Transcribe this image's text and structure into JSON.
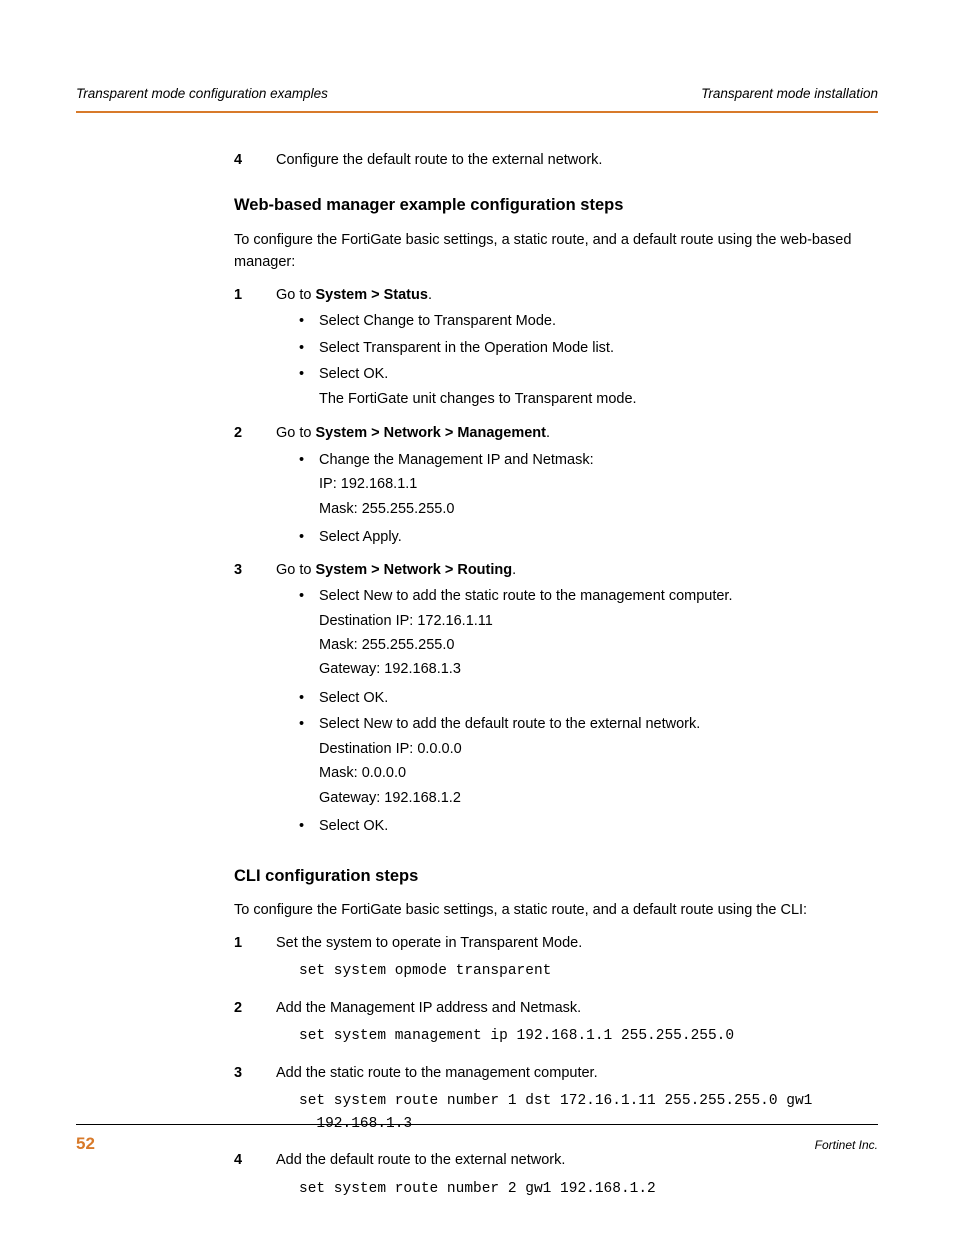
{
  "header": {
    "left": "Transparent mode configuration examples",
    "right": "Transparent mode installation"
  },
  "preStep": {
    "num": "4",
    "text": "Configure the default route to the external network."
  },
  "sectionA": {
    "title": "Web-based manager example configuration steps",
    "intro": "To configure the FortiGate basic settings, a static route, and a default route using the web-based manager:",
    "steps": [
      {
        "num": "1",
        "lead_pre": "Go to ",
        "lead_bold": "System > Status",
        "lead_post": ".",
        "bullets": [
          {
            "text": "Select Change to Transparent Mode."
          },
          {
            "text": "Select Transparent in the Operation Mode list."
          },
          {
            "text": "Select OK.",
            "sublines": [
              "The FortiGate unit changes to Transparent mode."
            ]
          }
        ]
      },
      {
        "num": "2",
        "lead_pre": "Go to ",
        "lead_bold": "System > Network > Management",
        "lead_post": ".",
        "bullets": [
          {
            "text": "Change the Management IP and Netmask:",
            "sublines": [
              "IP: 192.168.1.1",
              "Mask: 255.255.255.0"
            ]
          },
          {
            "text": "Select Apply."
          }
        ]
      },
      {
        "num": "3",
        "lead_pre": "Go to ",
        "lead_bold": "System > Network > Routing",
        "lead_post": ".",
        "bullets": [
          {
            "text": "Select New to add the static route to the management computer.",
            "sublines": [
              "Destination IP: 172.16.1.11",
              "Mask: 255.255.255.0",
              "Gateway: 192.168.1.3"
            ]
          },
          {
            "text": "Select OK."
          },
          {
            "text": "Select New to add the default route to the external network.",
            "sublines": [
              "Destination IP: 0.0.0.0",
              "Mask: 0.0.0.0",
              "Gateway: 192.168.1.2"
            ]
          },
          {
            "text": "Select OK."
          }
        ]
      }
    ]
  },
  "sectionB": {
    "title": "CLI configuration steps",
    "intro": "To configure the FortiGate basic settings, a static route, and a default route using the CLI:",
    "steps": [
      {
        "num": "1",
        "text": "Set the system to operate in Transparent Mode.",
        "code": "set system opmode transparent"
      },
      {
        "num": "2",
        "text": "Add the Management IP address and Netmask.",
        "code": "set system management ip 192.168.1.1 255.255.255.0"
      },
      {
        "num": "3",
        "text": "Add the static route to the management computer.",
        "code": "set system route number 1 dst 172.16.1.11 255.255.255.0 gw1 \n  192.168.1.3"
      },
      {
        "num": "4",
        "text": "Add the default route to the external network.",
        "code": "set system route number 2 gw1 192.168.1.2"
      }
    ]
  },
  "footer": {
    "page": "52",
    "right": "Fortinet Inc."
  }
}
